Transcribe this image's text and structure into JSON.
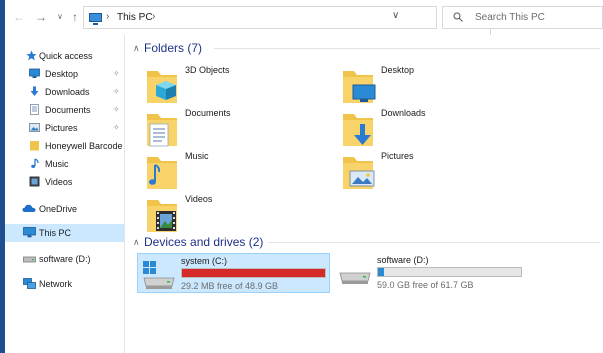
{
  "colors": {
    "accent_blue": "#1e3287",
    "selection": "#cce8ff",
    "folder_yellow": "#f0c44a",
    "drive_full_red": "#d42a2a",
    "drive_ok_blue": "#2a8ad4"
  },
  "address_bar": {
    "path_label": "This PC",
    "search_placeholder": "Search This PC"
  },
  "sidebar": {
    "items": [
      {
        "label": "Quick access",
        "icon": "star-icon"
      },
      {
        "label": "Desktop",
        "icon": "desktop-icon",
        "pinned": true
      },
      {
        "label": "Downloads",
        "icon": "downloads-icon",
        "pinned": true
      },
      {
        "label": "Documents",
        "icon": "documents-icon",
        "pinned": true
      },
      {
        "label": "Pictures",
        "icon": "pictures-icon",
        "pinned": true
      },
      {
        "label": "Honeywell Barcode",
        "icon": "folder-icon"
      },
      {
        "label": "Music",
        "icon": "music-icon"
      },
      {
        "label": "Videos",
        "icon": "videos-icon"
      },
      {
        "label": "OneDrive",
        "icon": "cloud-icon"
      },
      {
        "label": "This PC",
        "icon": "this-pc-icon",
        "selected": true
      },
      {
        "label": "software (D:)",
        "icon": "drive-icon"
      },
      {
        "label": "Network",
        "icon": "network-icon"
      }
    ]
  },
  "content": {
    "folders_header": "Folders (7)",
    "folders": [
      {
        "label": "3D Objects",
        "icon": "3d-objects-folder-icon"
      },
      {
        "label": "Desktop",
        "icon": "desktop-folder-icon"
      },
      {
        "label": "Documents",
        "icon": "documents-folder-icon"
      },
      {
        "label": "Downloads",
        "icon": "downloads-folder-icon"
      },
      {
        "label": "Music",
        "icon": "music-folder-icon"
      },
      {
        "label": "Pictures",
        "icon": "pictures-folder-icon"
      },
      {
        "label": "Videos",
        "icon": "videos-folder-icon"
      }
    ],
    "drives_header": "Devices and drives (2)",
    "drives": [
      {
        "name": "system (C:)",
        "free_text": "29.2 MB free of 48.9 GB",
        "used_fraction": 0.999,
        "bar_color": "#d42a2a",
        "selected": true,
        "windows_logo": true
      },
      {
        "name": "software (D:)",
        "free_text": "59.0 GB free of 61.7 GB",
        "used_fraction": 0.044,
        "bar_color": "#2a8ad4",
        "selected": false,
        "windows_logo": false
      }
    ]
  }
}
